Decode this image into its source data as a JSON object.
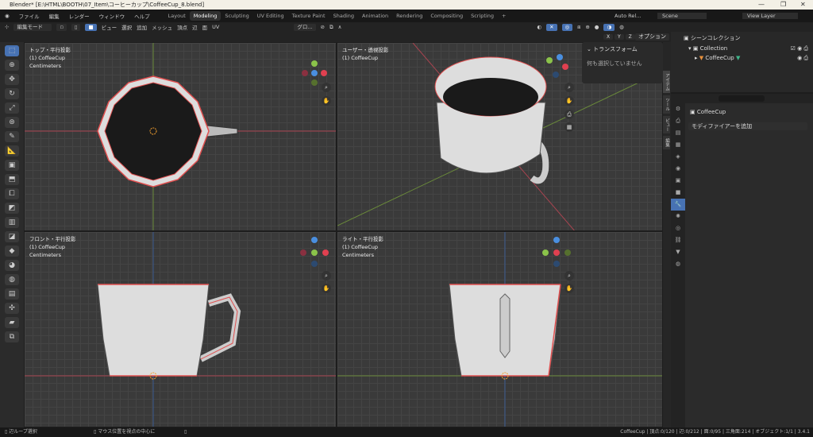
{
  "window": {
    "title": "Blender* [E:\\HTML\\BOOTH\\07_Item\\コーヒーカップ\\CoffeeCup_8.blend]",
    "minimize": "—",
    "maximize": "❐",
    "close": "✕"
  },
  "menu": [
    "ファイル",
    "編集",
    "レンダー",
    "ウィンドウ",
    "ヘルプ"
  ],
  "workspaces": [
    "Layout",
    "Modeling",
    "Sculpting",
    "UV Editing",
    "Texture Paint",
    "Shading",
    "Animation",
    "Rendering",
    "Compositing",
    "Scripting",
    "+"
  ],
  "active_workspace": "Modeling",
  "topright": {
    "auto_refresh": "Auto Rel...",
    "scene": "Scene",
    "view_layer": "View Layer"
  },
  "header": {
    "mode": "編集モード",
    "menus": [
      "ビュー",
      "選択",
      "追加",
      "メッシュ",
      "頂点",
      "辺",
      "面",
      "UV"
    ],
    "orientation": "グロ...",
    "options": "オプション",
    "axes": [
      "X",
      "Y",
      "Z"
    ]
  },
  "viewports": [
    {
      "title": "トップ・平行投影",
      "object": "(1) CoffeeCup",
      "units": "Centimeters"
    },
    {
      "title": "ユーザー・透視投影",
      "object": "(1) CoffeeCup",
      "units": ""
    },
    {
      "title": "フロント・平行投影",
      "object": "(1) CoffeeCup",
      "units": "Centimeters"
    },
    {
      "title": "ライト・平行投影",
      "object": "(1) CoffeeCup",
      "units": "Centimeters"
    }
  ],
  "npanel": {
    "section": "トランスフォーム",
    "message": "何も選択していません",
    "tabs": [
      "アイテム",
      "ツール",
      "ビュー",
      "編集"
    ]
  },
  "outliner": {
    "root": "シーンコレクション",
    "collection": "Collection",
    "object": "CoffeeCup"
  },
  "properties": {
    "object": "CoffeeCup",
    "add_modifier": "モディファイアーを追加"
  },
  "status": {
    "left": [
      "辺ループ選択",
      "マウス位置を視点の中心に",
      ""
    ],
    "right": "CoffeeCup | 頂点:0/120 | 辺:0/212 | 面:0/95 | 三角面:214 | オブジェクト:1/1 | 3.4.1"
  },
  "colors": {
    "accent": "#4772b3",
    "x_axis": "#e04050",
    "y_axis": "#8bc34a",
    "z_axis": "#4a8fe0",
    "edge_select": "#e05050"
  }
}
